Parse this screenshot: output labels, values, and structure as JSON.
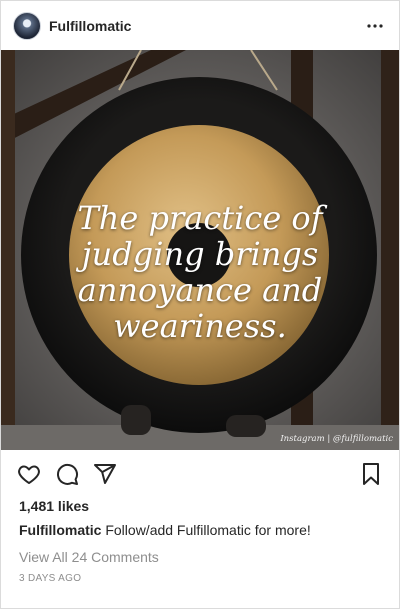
{
  "header": {
    "username": "Fulfillomatic",
    "avatar_icon": "user-avatar",
    "more_icon": "more-horizontal-icon"
  },
  "post": {
    "quote": "The practice of judging brings annoyance and weariness.",
    "watermark": "Instagram | @fulfillomatic",
    "image_description_icon": "gong-photo"
  },
  "actions": {
    "like_icon": "heart-icon",
    "comment_icon": "comment-icon",
    "share_icon": "share-icon",
    "save_icon": "bookmark-icon"
  },
  "likes": "1,481 likes",
  "caption": {
    "username": "Fulfillomatic",
    "text": "Follow/add Fulfillomatic for more!"
  },
  "comments_link": "View All 24 Comments",
  "timestamp": "3 DAYS AGO",
  "colors": {
    "text": "#262626",
    "muted": "#8e8e8e",
    "border": "#dbdbdb"
  }
}
